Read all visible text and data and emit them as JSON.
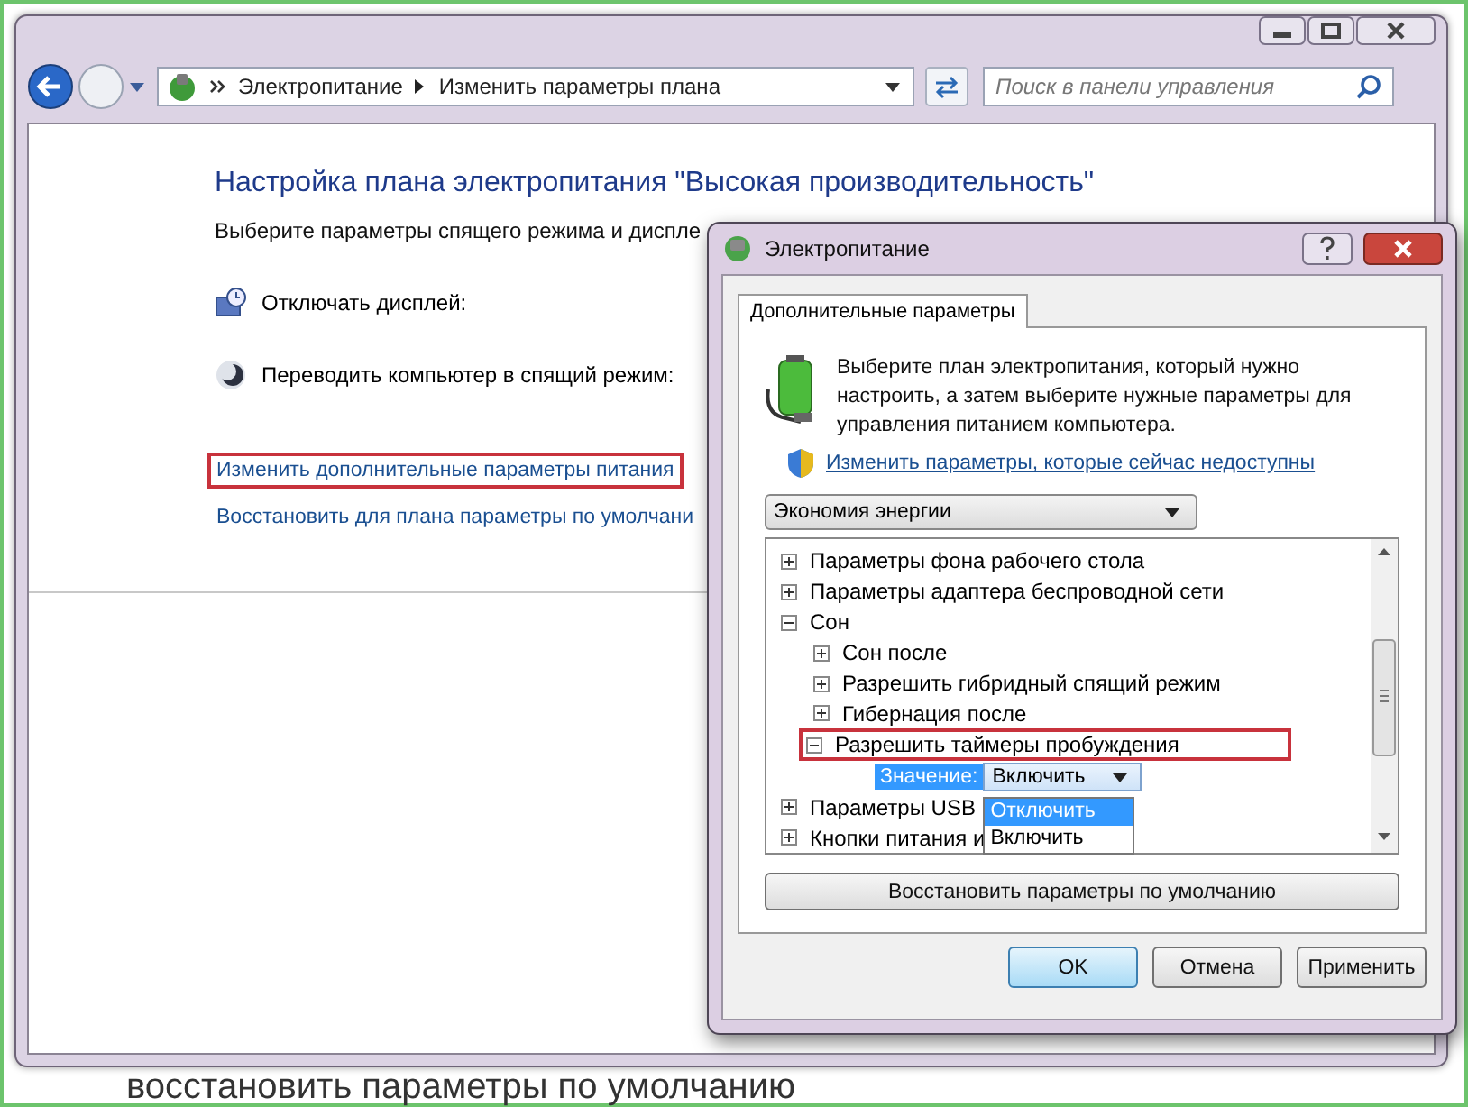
{
  "background_document": {
    "body_text": "восстановить параметры по умолчанию"
  },
  "address_bar": {
    "breadcrumbs": [
      "Электропитание",
      "Изменить параметры плана"
    ]
  },
  "search": {
    "placeholder": "Поиск в панели управления"
  },
  "content": {
    "title": "Настройка плана электропитания \"Высокая производительность\"",
    "subtitle": "Выберите параметры спящего режима и диспле",
    "settings": [
      {
        "kind": "display",
        "label": "Отключать дисплей:"
      },
      {
        "kind": "sleep",
        "label": "Переводить компьютер в спящий режим:"
      }
    ],
    "links": [
      {
        "label": "Изменить дополнительные параметры питания",
        "highlighted": true
      },
      {
        "label": "Восстановить для плана параметры по умолчани",
        "highlighted": false
      }
    ]
  },
  "dialog": {
    "title": "Электропитание",
    "tabs": [
      {
        "label": "Дополнительные параметры",
        "selected": true
      }
    ],
    "intro": "Выберите план электропитания, который нужно настроить, а затем выберите нужные параметры для управления питанием компьютера.",
    "admin_link": "Изменить параметры, которые сейчас недоступны",
    "plan_select": {
      "value": "Экономия энергии"
    },
    "tree": [
      {
        "label": "Параметры фона рабочего стола",
        "expanded": false
      },
      {
        "label": "Параметры адаптера беспроводной сети",
        "expanded": false
      },
      {
        "label": "Сон",
        "expanded": true,
        "children": [
          {
            "label": "Сон после",
            "expanded": false
          },
          {
            "label": "Разрешить гибридный спящий режим",
            "expanded": false
          },
          {
            "label": "Гибернация после",
            "expanded": false
          },
          {
            "label": "Разрешить таймеры пробуждения",
            "expanded": true,
            "highlighted": true,
            "value_editor": {
              "label": "Значение:",
              "value": "Включить",
              "options": [
                {
                  "label": "Отключить",
                  "highlighted": true
                },
                {
                  "label": "Включить",
                  "highlighted": false
                }
              ]
            }
          }
        ]
      },
      {
        "label": "Параметры USB",
        "expanded": false
      },
      {
        "label": "Кнопки питания и",
        "expanded": false
      }
    ],
    "restore_button": "Восстановить параметры по умолчанию",
    "buttons": [
      {
        "label": "OK",
        "default": true
      },
      {
        "label": "Отмена",
        "default": false
      },
      {
        "label": "Применить",
        "default": false
      }
    ]
  }
}
